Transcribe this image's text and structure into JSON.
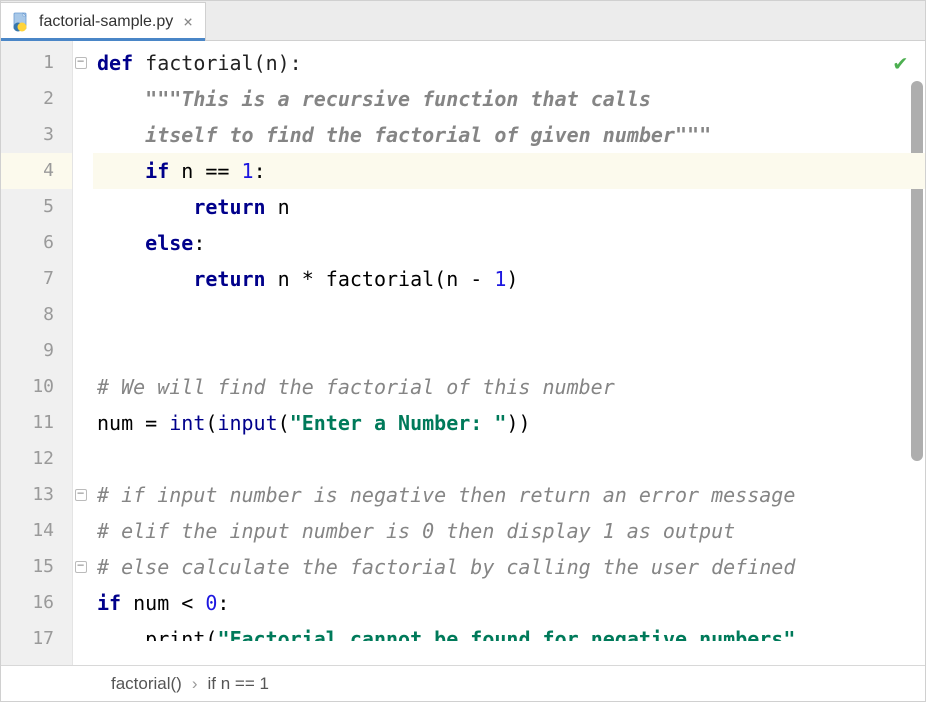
{
  "tab": {
    "filename": "factorial-sample.py",
    "close_glyph": "×"
  },
  "gutter": {
    "lines": [
      "1",
      "2",
      "3",
      "4",
      "5",
      "6",
      "7",
      "8",
      "9",
      "10",
      "11",
      "12",
      "13",
      "14",
      "15",
      "16",
      "17"
    ],
    "highlighted_line": 4
  },
  "folds": {
    "marks_at": [
      1,
      13,
      15
    ]
  },
  "code": {
    "l1": {
      "kw": "def ",
      "name": "factorial(n):"
    },
    "l2": {
      "indent": "    ",
      "q": "\"\"\"",
      "t": "This is a recursive function that calls"
    },
    "l3": {
      "indent": "    ",
      "t": "itself to find the factorial of given number",
      "q": "\"\"\""
    },
    "l4": {
      "indent": "    ",
      "kw": "if ",
      "expr": "n == ",
      "num": "1",
      "colon": ":"
    },
    "l5": {
      "indent": "        ",
      "kw": "return ",
      "expr": "n"
    },
    "l6": {
      "indent": "    ",
      "kw": "else",
      "colon": ":"
    },
    "l7": {
      "indent": "        ",
      "kw": "return ",
      "expr": "n * factorial(n - ",
      "num": "1",
      "tail": ")"
    },
    "l8": "",
    "l9": "",
    "l10": {
      "cm": "# We will find the factorial of this number"
    },
    "l11": {
      "a": "num = ",
      "bi": "int",
      "b": "(",
      "bi2": "input",
      "c": "(",
      "str": "\"Enter a Number: \"",
      "d": "))"
    },
    "l12": "",
    "l13": {
      "cm": "# if input number is negative then return an error message"
    },
    "l14": {
      "cm": "# elif the input number is 0 then display 1 as output"
    },
    "l15": {
      "cm": "# else calculate the factorial by calling the user defined"
    },
    "l16": {
      "kw": "if ",
      "expr": "num < ",
      "num": "0",
      "colon": ":"
    },
    "l17": {
      "indent": "    ",
      "fn": "print",
      "p": "(",
      "str": "\"Factorial cannot be found for negative numbers\""
    }
  },
  "breadcrumb": {
    "item1": "factorial()",
    "sep": "›",
    "item2": "if n == 1"
  },
  "status": {
    "check": "✔"
  },
  "chart_data": null
}
